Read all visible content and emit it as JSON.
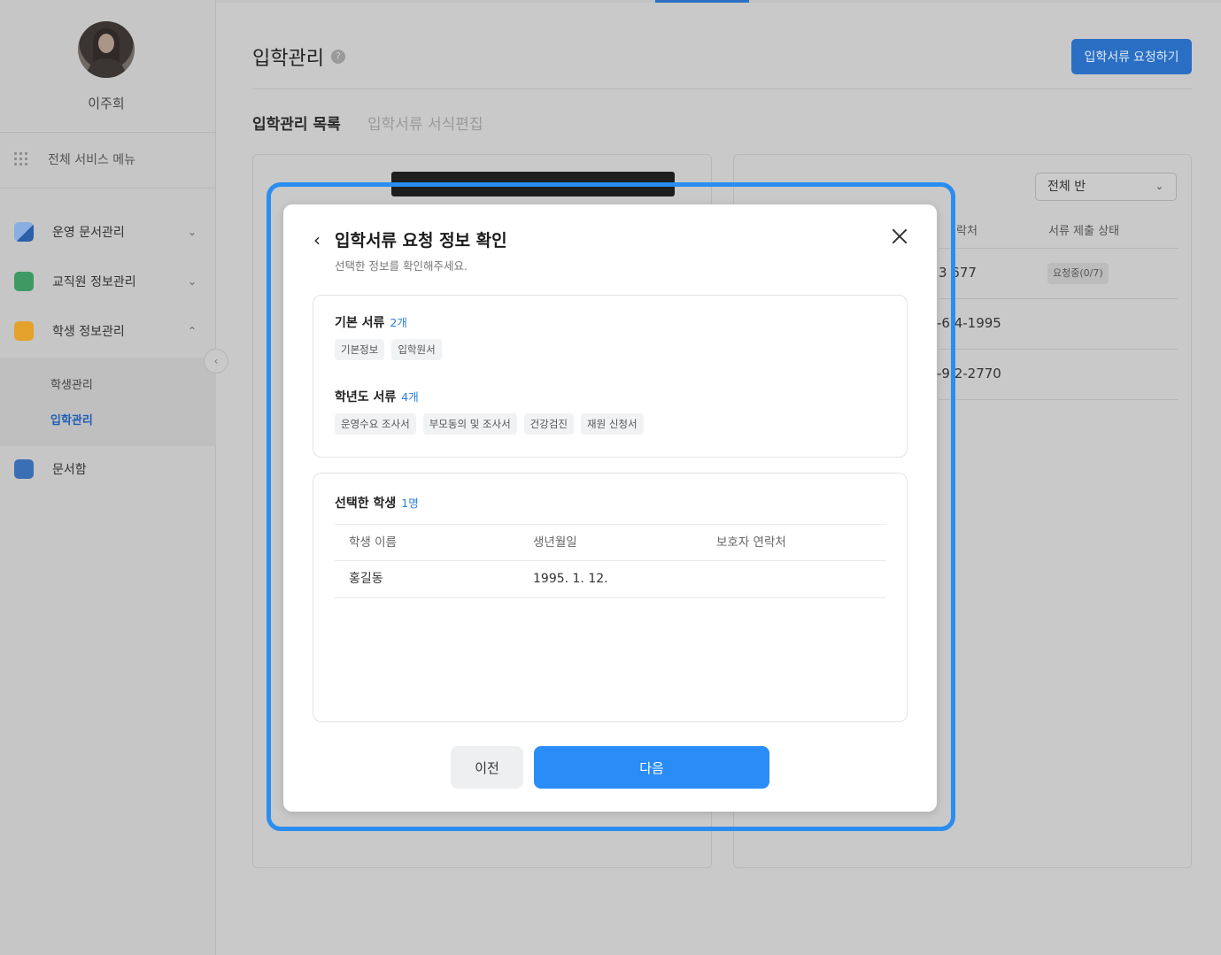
{
  "sidebar": {
    "user_name": "이주희",
    "all_menu_label": "전체 서비스 메뉴",
    "items": [
      {
        "label": "운영 문서관리",
        "icon": "document-folder-icon",
        "expanded": false
      },
      {
        "label": "교직원 정보관리",
        "icon": "staff-card-icon",
        "expanded": false
      },
      {
        "label": "학생 정보관리",
        "icon": "student-face-icon",
        "expanded": true
      },
      {
        "label": "문서함",
        "icon": "document-box-icon",
        "expanded": false
      }
    ],
    "sub_items": [
      {
        "label": "학생관리",
        "active": false
      },
      {
        "label": "입학관리",
        "active": true
      }
    ]
  },
  "header": {
    "title": "입학관리",
    "help_icon": "?",
    "request_button": "입학서류 요청하기"
  },
  "tabs": [
    {
      "label": "입학관리 목록",
      "active": true
    },
    {
      "label": "입학서류 서식편집",
      "active": false
    }
  ],
  "right_panel": {
    "class_select": "전체 반",
    "columns": [
      "락처",
      "서류 제출 상태"
    ],
    "rows": [
      {
        "phone": "3  677",
        "status": "요청중(0/7)"
      },
      {
        "phone": "-6  4-1995",
        "status": ""
      },
      {
        "phone": "-9  2-2770",
        "status": ""
      }
    ]
  },
  "modal": {
    "title": "입학서류 요청 정보 확인",
    "subtitle": "선택한 정보를 확인해주세요.",
    "basic_docs": {
      "title": "기본 서류",
      "count": "2개",
      "items": [
        "기본정보",
        "입학원서"
      ]
    },
    "grade_docs": {
      "title": "학년도 서류",
      "count": "4개",
      "items": [
        "운영수요 조사서",
        "부모동의 및 조사서",
        "건강검진",
        "재원 신청서"
      ]
    },
    "selected_students": {
      "title": "선택한 학생",
      "count": "1명",
      "columns": [
        "학생 이름",
        "생년월일",
        "보호자 연락처"
      ],
      "rows": [
        {
          "name": "홍길동",
          "birth": "1995. 1. 12.",
          "guardian_phone": ""
        }
      ]
    },
    "prev_button": "이전",
    "next_button": "다음"
  },
  "colors": {
    "accent": "#2a8cf7",
    "ring": "#2a8df0",
    "count_text": "#2a7fe0"
  }
}
